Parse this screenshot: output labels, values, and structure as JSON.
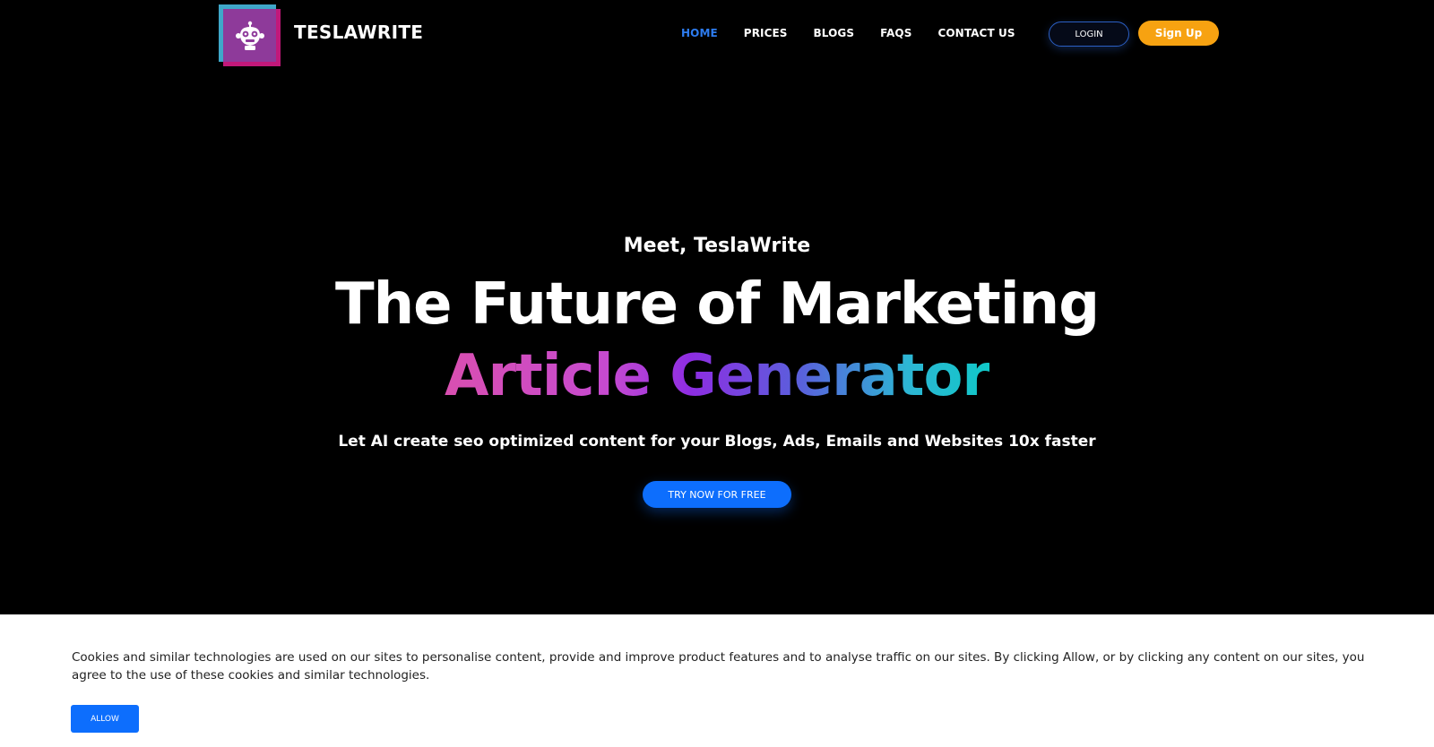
{
  "header": {
    "brand": "TESLAWRITE",
    "nav": [
      {
        "label": "HOME",
        "active": true
      },
      {
        "label": "PRICES",
        "active": false
      },
      {
        "label": "BLOGS",
        "active": false
      },
      {
        "label": "FAQS",
        "active": false
      },
      {
        "label": "CONTACT US",
        "active": false
      }
    ],
    "login_label": "LOGIN",
    "signup_label": "Sign Up"
  },
  "hero": {
    "eyebrow": "Meet, TeslaWrite",
    "title": "The Future of Marketing",
    "gradient_title": "Article Generator",
    "subtitle": "Let AI create seo optimized content for your Blogs, Ads, Emails and Websites 10x faster",
    "cta_label": "TRY NOW FOR FREE"
  },
  "cookie_banner": {
    "text": "Cookies and similar technologies are used on our sites to personalise content, provide and improve product features and to analyse traffic on our sites. By clicking Allow, or by clicking any content on our sites, you agree to the use of these cookies and similar technologies.",
    "allow_label": "ALLOW"
  },
  "colors": {
    "background": "#000000",
    "accent_blue": "#0d6efd",
    "nav_active": "#2d7cf0",
    "signup_orange": "#f7a211",
    "logo_purple": "#8e3a9a"
  },
  "icons": {
    "logo": "robot-head-icon"
  }
}
